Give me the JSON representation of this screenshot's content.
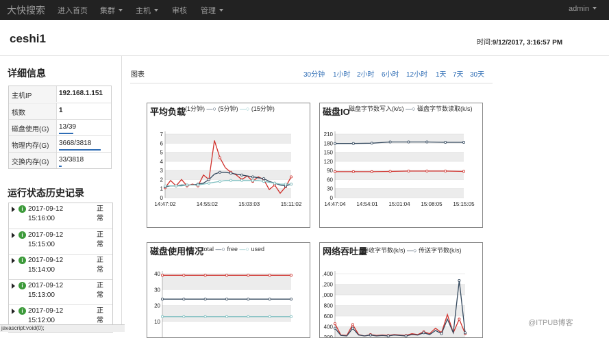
{
  "navbar": {
    "brand": "大快搜索",
    "items": [
      {
        "label": "进入首页",
        "caret": false
      },
      {
        "label": "集群",
        "caret": true
      },
      {
        "label": "主机",
        "caret": true
      },
      {
        "label": "审核",
        "caret": false
      },
      {
        "label": "管理",
        "caret": true
      }
    ],
    "user": "admin"
  },
  "page": {
    "title": "ceshi1",
    "time_label": "时间:",
    "time_value": "9/12/2017, 3:16:57 PM"
  },
  "details": {
    "heading": "详细信息",
    "rows": [
      {
        "key": "主机IP",
        "value": "192.168.1.151",
        "bold": true,
        "usage": null
      },
      {
        "key": "核数",
        "value": "1",
        "bold": true,
        "usage": null
      },
      {
        "key": "磁盘使用(G)",
        "value": "13/39",
        "bold": false,
        "usage": 0.33
      },
      {
        "key": "物理内存(G)",
        "value": "3668/3818",
        "bold": false,
        "usage": 0.96
      },
      {
        "key": "交换内存(G)",
        "value": "33/3818",
        "bold": false,
        "usage": 0.01
      }
    ]
  },
  "history": {
    "heading": "运行状态历史记录",
    "entries": [
      {
        "time": "2017-09-12 15:16:00",
        "state": "正常"
      },
      {
        "time": "2017-09-12 15:15:00",
        "state": "正常"
      },
      {
        "time": "2017-09-12 15:14:00",
        "state": "正常"
      },
      {
        "time": "2017-09-12 15:13:00",
        "state": "正常"
      },
      {
        "time": "2017-09-12 15:12:00",
        "state": "正常"
      }
    ],
    "info_glyph": "i"
  },
  "statusbar": {
    "text": "javascript:void(0);"
  },
  "charts_header": {
    "label": "图表",
    "ranges": [
      "30分钟",
      "1小时",
      "2小时",
      "6小时",
      "12小时",
      "1天",
      "7天",
      "30天"
    ]
  },
  "colors": {
    "accent": "#2f6db5",
    "red": "#d0302b",
    "dark": "#34495e",
    "teal": "#7fbfc0",
    "ok": "#3c9a3a"
  },
  "watermark": "@ITPUB博客",
  "chart_data": [
    {
      "type": "line",
      "title": "平均负载",
      "legend": [
        "(1分钟)",
        "(5分钟)",
        "(15分钟)"
      ],
      "x_ticks": [
        "14:47:02",
        "14:55:02",
        "15:03:03",
        "15:11:02"
      ],
      "ylim": [
        0,
        7
      ],
      "y_ticks": [
        0,
        1,
        2,
        3,
        4,
        5,
        6,
        7
      ],
      "grid": true,
      "series": [
        {
          "name": "(1分钟)",
          "color": "#d0302b",
          "values": [
            1.1,
            1.9,
            1.3,
            2.0,
            1.3,
            1.5,
            1.3,
            2.5,
            2.0,
            6.3,
            4.4,
            3.3,
            2.8,
            2.5,
            2.0,
            2.4,
            1.8,
            2.3,
            2.0,
            0.9,
            1.4,
            0.5,
            1.2,
            2.3
          ]
        },
        {
          "name": "(5分钟)",
          "color": "#34495e",
          "values": [
            1.2,
            1.3,
            1.3,
            1.4,
            1.4,
            1.4,
            1.5,
            1.6,
            2.0,
            2.6,
            2.8,
            2.8,
            2.7,
            2.6,
            2.5,
            2.4,
            2.3,
            2.2,
            2.1,
            1.8,
            1.6,
            1.4,
            1.3,
            1.5
          ]
        },
        {
          "name": "(15分钟)",
          "color": "#7fbfc0",
          "values": [
            1.3,
            1.3,
            1.3,
            1.3,
            1.4,
            1.4,
            1.4,
            1.5,
            1.6,
            1.7,
            1.8,
            1.9,
            1.9,
            1.9,
            1.9,
            1.9,
            1.9,
            1.9,
            1.8,
            1.7,
            1.6,
            1.5,
            1.5,
            1.5
          ]
        }
      ]
    },
    {
      "type": "line",
      "title": "磁盘IO",
      "legend": [
        "磁盘字节数写入(k/s)",
        "磁盘字节数读取(k/s)"
      ],
      "x_ticks": [
        "14:47:04",
        "14:54:01",
        "15:01:04",
        "15:08:05",
        "15:15:05"
      ],
      "ylim": [
        0,
        210
      ],
      "y_ticks": [
        0,
        30,
        60,
        90,
        120,
        150,
        180,
        210
      ],
      "grid": true,
      "series": [
        {
          "name": "磁盘字节数写入(k/s)",
          "color": "#d0302b",
          "values": [
            86,
            86,
            86,
            87,
            88,
            88,
            88,
            87
          ]
        },
        {
          "name": "磁盘字节数读取(k/s)",
          "color": "#34495e",
          "values": [
            179,
            179,
            180,
            184,
            184,
            184,
            183,
            183
          ]
        }
      ]
    },
    {
      "type": "line",
      "title": "磁盘使用情况",
      "legend": [
        "total",
        "free",
        "used"
      ],
      "x_ticks": [],
      "ylim": [
        0,
        40
      ],
      "y_ticks": [
        10,
        20,
        30,
        40
      ],
      "grid": true,
      "series": [
        {
          "name": "total",
          "color": "#d0302b",
          "values": [
            39,
            39,
            39,
            39,
            39,
            39,
            39
          ]
        },
        {
          "name": "free",
          "color": "#34495e",
          "values": [
            24,
            24,
            24,
            24,
            24,
            24,
            24
          ]
        },
        {
          "name": "used",
          "color": "#7fbfc0",
          "values": [
            13,
            13,
            13,
            13,
            13,
            13,
            13
          ]
        }
      ]
    },
    {
      "type": "line",
      "title": "网络吞吐量",
      "legend": [
        "接收字节数(k/s)",
        "传送字节数(k/s)"
      ],
      "x_ticks": [],
      "y_ticks": [
        ",400",
        ",200",
        ",000",
        "800",
        "600",
        "400",
        "200"
      ],
      "grid": true,
      "series": [
        {
          "name": "接收字节数(k/s)",
          "color": "#d0302b",
          "values": [
            300,
            50,
            40,
            280,
            60,
            30,
            60,
            40,
            50,
            40,
            60,
            50,
            40,
            80,
            60,
            120,
            80,
            200,
            100,
            500,
            100,
            400,
            80
          ]
        },
        {
          "name": "传送字节数(k/s)",
          "color": "#34495e",
          "values": [
            200,
            40,
            30,
            200,
            50,
            30,
            50,
            30,
            40,
            30,
            50,
            40,
            30,
            60,
            50,
            100,
            60,
            150,
            80,
            400,
            100,
            1250,
            100
          ]
        }
      ]
    }
  ]
}
